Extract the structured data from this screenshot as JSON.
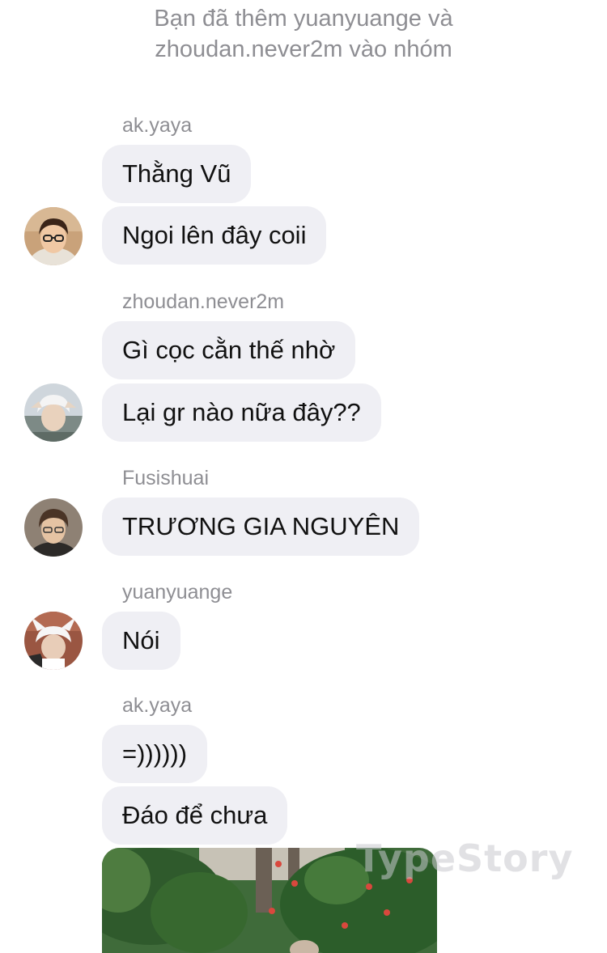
{
  "system_notice": {
    "line1": "Bạn đã thêm yuanyuange và",
    "line2": "zhoudan.never2m vào nhóm"
  },
  "messages": [
    {
      "sender": "ak.yaya",
      "bubbles": [
        "Thằng Vũ",
        "Ngoi lên đây coii"
      ]
    },
    {
      "sender": "zhoudan.never2m",
      "bubbles": [
        "Gì cọc cằn thế nhờ",
        "Lại gr nào nữa đây??"
      ]
    },
    {
      "sender": "Fusishuai",
      "bubbles": [
        "TRƯƠNG GIA NGUYÊN"
      ]
    },
    {
      "sender": "yuanyuange",
      "bubbles": [
        "Nói"
      ]
    },
    {
      "sender": "ak.yaya",
      "bubbles": [
        "=))))))",
        "Đáo để chưa"
      ]
    }
  ],
  "watermark": "TypeStory",
  "colors": {
    "bubble_bg": "#efeff4",
    "meta_text": "#8e8e93",
    "message_text": "#111111"
  }
}
